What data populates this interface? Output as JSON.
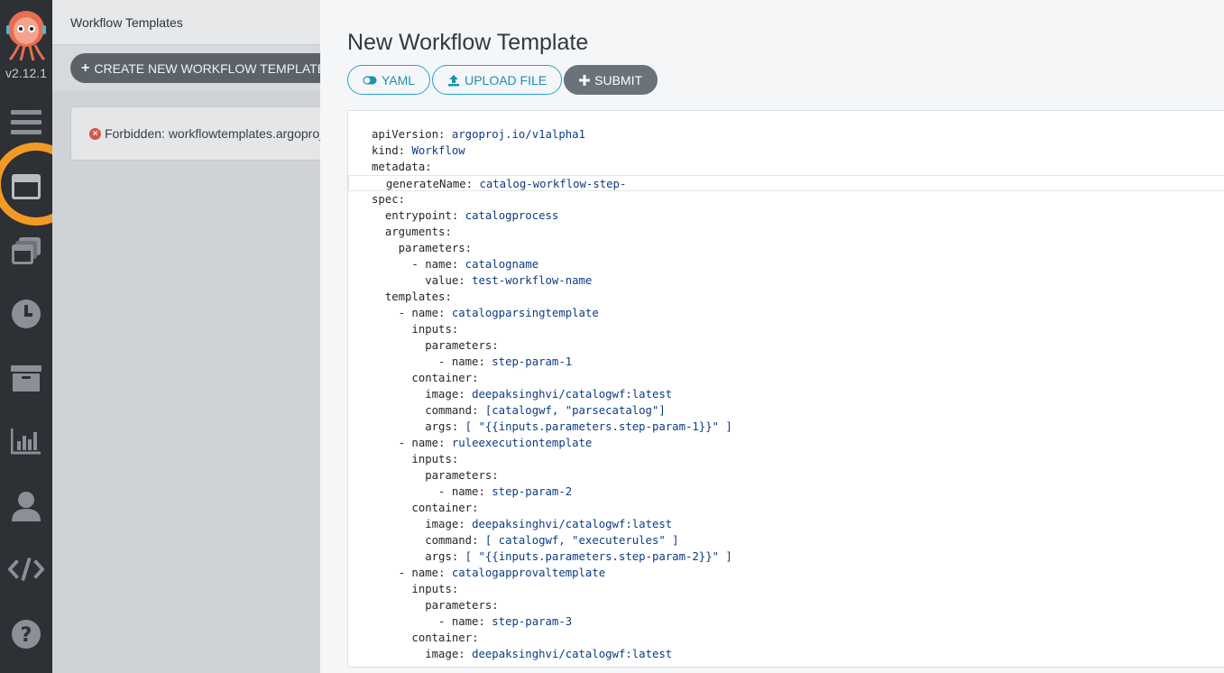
{
  "sidebar": {
    "version": "v2.12.1",
    "items": [
      {
        "icon": "menu-icon"
      },
      {
        "icon": "workflow-templates-icon",
        "highlighted": true
      },
      {
        "icon": "cluster-templates-icon"
      },
      {
        "icon": "clock-icon"
      },
      {
        "icon": "archive-icon"
      },
      {
        "icon": "bar-chart-icon"
      },
      {
        "icon": "user-icon"
      },
      {
        "icon": "code-icon"
      },
      {
        "icon": "help-icon"
      }
    ],
    "highlight_color": "#f39a24"
  },
  "background_page": {
    "title": "Workflow Templates",
    "create_button_label": "CREATE NEW WORKFLOW TEMPLATE",
    "error_message": "Forbidden: workflowtemplates.argoproj.io"
  },
  "panel": {
    "title": "New Workflow Template",
    "buttons": {
      "yaml": "YAML",
      "upload": "UPLOAD FILE",
      "submit": "SUBMIT"
    },
    "accent_color": "#26a6c9",
    "editor_lines": [
      {
        "indent": "",
        "key": "apiVersion",
        "val": "argoproj.io/v1alpha1"
      },
      {
        "indent": "",
        "key": "kind",
        "val": "Workflow"
      },
      {
        "indent": "",
        "key": "metadata",
        "val": ""
      },
      {
        "indent": "  ",
        "key": "generateName",
        "val": "catalog-workflow-step-"
      },
      {
        "indent": "",
        "key": "spec",
        "val": ""
      },
      {
        "indent": "  ",
        "key": "entrypoint",
        "val": "catalogprocess"
      },
      {
        "indent": "  ",
        "key": "arguments",
        "val": ""
      },
      {
        "indent": "    ",
        "key": "parameters",
        "val": ""
      },
      {
        "indent": "      - ",
        "key": "name",
        "val": "catalogname"
      },
      {
        "indent": "        ",
        "key": "value",
        "val": "test-workflow-name"
      },
      {
        "indent": "  ",
        "key": "templates",
        "val": ""
      },
      {
        "indent": "    - ",
        "key": "name",
        "val": "catalogparsingtemplate"
      },
      {
        "indent": "      ",
        "key": "inputs",
        "val": ""
      },
      {
        "indent": "        ",
        "key": "parameters",
        "val": ""
      },
      {
        "indent": "          - ",
        "key": "name",
        "val": "step-param-1"
      },
      {
        "indent": "      ",
        "key": "container",
        "val": ""
      },
      {
        "indent": "        ",
        "key": "image",
        "val": "deepaksinghvi/catalogwf:latest"
      },
      {
        "indent": "        ",
        "key": "command",
        "val": "[catalogwf, \"parsecatalog\"]"
      },
      {
        "indent": "        ",
        "key": "args",
        "val": "[ \"{{inputs.parameters.step-param-1}}\" ]"
      },
      {
        "indent": "    - ",
        "key": "name",
        "val": "ruleexecutiontemplate"
      },
      {
        "indent": "      ",
        "key": "inputs",
        "val": ""
      },
      {
        "indent": "        ",
        "key": "parameters",
        "val": ""
      },
      {
        "indent": "          - ",
        "key": "name",
        "val": "step-param-2"
      },
      {
        "indent": "      ",
        "key": "container",
        "val": ""
      },
      {
        "indent": "        ",
        "key": "image",
        "val": "deepaksinghvi/catalogwf:latest"
      },
      {
        "indent": "        ",
        "key": "command",
        "val": "[ catalogwf, \"executerules\" ]"
      },
      {
        "indent": "        ",
        "key": "args",
        "val": "[ \"{{inputs.parameters.step-param-2}}\" ]"
      },
      {
        "indent": "    - ",
        "key": "name",
        "val": "catalogapprovaltemplate"
      },
      {
        "indent": "      ",
        "key": "inputs",
        "val": ""
      },
      {
        "indent": "        ",
        "key": "parameters",
        "val": ""
      },
      {
        "indent": "          - ",
        "key": "name",
        "val": "step-param-3"
      },
      {
        "indent": "      ",
        "key": "container",
        "val": ""
      },
      {
        "indent": "        ",
        "key": "image",
        "val": "deepaksinghvi/catalogwf:latest"
      }
    ]
  }
}
